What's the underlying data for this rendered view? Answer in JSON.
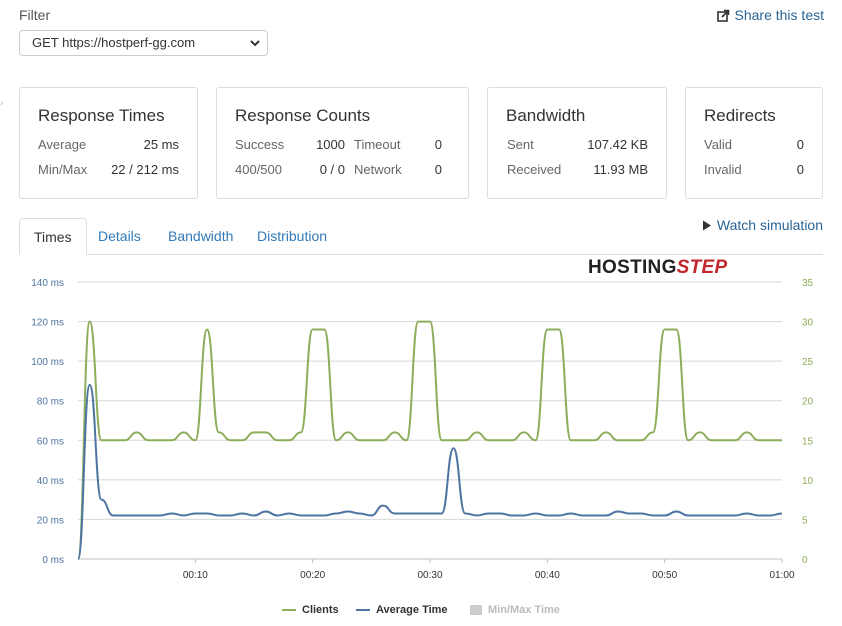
{
  "filter": {
    "label": "Filter",
    "selected": "GET https://hostperf-gg.com"
  },
  "share_label": "Share this test",
  "cards": {
    "response_times": {
      "title": "Response Times",
      "average_label": "Average",
      "average_value": "25 ms",
      "minmax_label": "Min/Max",
      "minmax_value": "22 / 212 ms"
    },
    "response_counts": {
      "title": "Response Counts",
      "success_label": "Success",
      "success_value": "1000",
      "timeout_label": "Timeout",
      "timeout_value": "0",
      "errors_label": "400/500",
      "errors_value": "0 / 0",
      "network_label": "Network",
      "network_value": "0"
    },
    "bandwidth": {
      "title": "Bandwidth",
      "sent_label": "Sent",
      "sent_value": "107.42 KB",
      "received_label": "Received",
      "received_value": "11.93 MB"
    },
    "redirects": {
      "title": "Redirects",
      "valid_label": "Valid",
      "valid_value": "0",
      "invalid_label": "Invalid",
      "invalid_value": "0"
    }
  },
  "tabs": [
    {
      "label": "Times",
      "active": true
    },
    {
      "label": "Details",
      "active": false
    },
    {
      "label": "Bandwidth",
      "active": false
    },
    {
      "label": "Distribution",
      "active": false
    }
  ],
  "watch_label": "Watch simulation",
  "logo": {
    "part1": "HOSTING",
    "part2": "STEP"
  },
  "colors": {
    "clients": "#8cad5a",
    "average_time": "#4e74a1",
    "minmax": "#cccccc",
    "link": "#2a6496"
  },
  "chart_data": {
    "type": "line",
    "x": [
      "00:00",
      "00:01",
      "00:02",
      "00:03",
      "00:04",
      "00:05",
      "00:06",
      "00:07",
      "00:08",
      "00:09",
      "00:10",
      "00:11",
      "00:12",
      "00:13",
      "00:14",
      "00:15",
      "00:16",
      "00:17",
      "00:18",
      "00:19",
      "00:20",
      "00:21",
      "00:22",
      "00:23",
      "00:24",
      "00:25",
      "00:26",
      "00:27",
      "00:28",
      "00:29",
      "00:30",
      "00:31",
      "00:32",
      "00:33",
      "00:34",
      "00:35",
      "00:36",
      "00:37",
      "00:38",
      "00:39",
      "00:40",
      "00:41",
      "00:42",
      "00:43",
      "00:44",
      "00:45",
      "00:46",
      "00:47",
      "00:48",
      "00:49",
      "00:50",
      "00:51",
      "00:52",
      "00:53",
      "00:54",
      "00:55",
      "00:56",
      "00:57",
      "00:58",
      "00:59",
      "01:00"
    ],
    "x_ticks": [
      "00:10",
      "00:20",
      "00:30",
      "00:40",
      "00:50",
      "01:00"
    ],
    "y_left_ticks": [
      "0 ms",
      "20 ms",
      "40 ms",
      "60 ms",
      "80 ms",
      "100 ms",
      "120 ms",
      "140 ms"
    ],
    "y_right_ticks": [
      "0",
      "5",
      "10",
      "15",
      "20",
      "25",
      "30",
      "35"
    ],
    "ylim_left": [
      0,
      140
    ],
    "ylim_right": [
      0,
      35
    ],
    "grid": true,
    "legend_position": "bottom",
    "series": [
      {
        "name": "Clients",
        "axis": "right",
        "values": [
          0,
          30,
          15,
          15,
          15,
          16,
          15,
          15,
          15,
          16,
          15,
          29,
          16,
          15,
          15,
          16,
          16,
          15,
          15,
          16,
          29,
          29,
          15,
          16,
          15,
          15,
          15,
          16,
          15,
          30,
          30,
          15,
          15,
          15,
          16,
          15,
          15,
          15,
          16,
          15,
          29,
          29,
          15,
          15,
          15,
          16,
          15,
          15,
          15,
          16,
          29,
          29,
          15,
          16,
          15,
          15,
          15,
          16,
          15,
          15,
          15
        ]
      },
      {
        "name": "Average Time",
        "axis": "left",
        "values": [
          0,
          88,
          30,
          22,
          22,
          22,
          22,
          22,
          23,
          22,
          23,
          23,
          22,
          22,
          23,
          22,
          24,
          22,
          23,
          22,
          22,
          22,
          23,
          24,
          23,
          22,
          27,
          23,
          23,
          23,
          23,
          23,
          56,
          23,
          22,
          23,
          23,
          22,
          22,
          23,
          22,
          22,
          23,
          22,
          22,
          22,
          24,
          23,
          23,
          22,
          22,
          24,
          22,
          22,
          22,
          22,
          22,
          23,
          22,
          22,
          23
        ]
      },
      {
        "name": "Min/Max Time",
        "axis": "left",
        "hidden": true,
        "values": []
      }
    ]
  }
}
